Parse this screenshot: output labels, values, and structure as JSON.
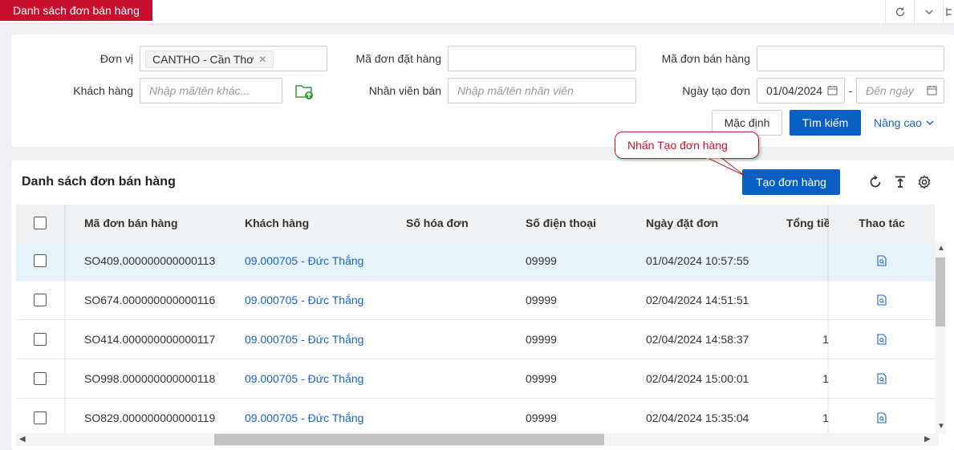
{
  "tab": {
    "title": "Danh sách đơn bán hàng"
  },
  "filters": {
    "don_vi_label": "Đơn vị",
    "don_vi_tag": "CANTHO - Cần Thơ",
    "ma_don_dat_label": "Mã đơn đặt hàng",
    "ma_don_dat_value": "",
    "ma_don_ban_label": "Mã đơn bán hàng",
    "ma_don_ban_value": "",
    "khach_hang_label": "Khách hàng",
    "khach_hang_placeholder": "Nhập mã/tên khác...",
    "nhan_vien_label": "Nhân viên bán",
    "nhan_vien_placeholder": "Nhập mã/tên nhân viên",
    "ngay_tao_label": "Ngày tạo đơn",
    "ngay_tu": "01/04/2024",
    "date_sep": "-",
    "ngay_den_placeholder": "Đến ngày",
    "btn_default": "Mặc định",
    "btn_search": "Tìm kiếm",
    "advanced": "Nâng cao"
  },
  "callout": {
    "text": "Nhấn Tạo đơn hàng"
  },
  "list": {
    "title": "Danh sách đơn bán hàng",
    "create_button": "Tạo đơn hàng"
  },
  "table": {
    "columns": [
      "Mã đơn bán hàng",
      "Khách hàng",
      "Số hóa đơn",
      "Số điện thoại",
      "Ngày đặt đơn",
      "Tổng tiền",
      "Thao tác"
    ],
    "rows": [
      {
        "ma": "SO409.000000000000113",
        "khach": "09.000705 - Đức Thắng",
        "hoa_don": "",
        "sdt": "09999",
        "ngay": "01/04/2024 10:57:55",
        "tong": ""
      },
      {
        "ma": "SO674.000000000000116",
        "khach": "09.000705 - Đức Thắng",
        "hoa_don": "",
        "sdt": "09999",
        "ngay": "02/04/2024 14:51:51",
        "tong": ""
      },
      {
        "ma": "SO414.000000000000117",
        "khach": "09.000705 - Đức Thắng",
        "hoa_don": "",
        "sdt": "09999",
        "ngay": "02/04/2024 14:58:37",
        "tong": "1"
      },
      {
        "ma": "SO998.000000000000118",
        "khach": "09.000705 - Đức Thắng",
        "hoa_don": "",
        "sdt": "09999",
        "ngay": "02/04/2024 15:00:01",
        "tong": "1"
      },
      {
        "ma": "SO829.000000000000119",
        "khach": "09.000705 - Đức Thắng",
        "hoa_don": "",
        "sdt": "09999",
        "ngay": "02/04/2024 15:35:04",
        "tong": "1"
      }
    ]
  },
  "colors": {
    "brand_red": "#c8102e",
    "primary_blue": "#0a5fc4",
    "link_blue": "#1a63c6",
    "row_highlight": "#e6f3fb"
  }
}
